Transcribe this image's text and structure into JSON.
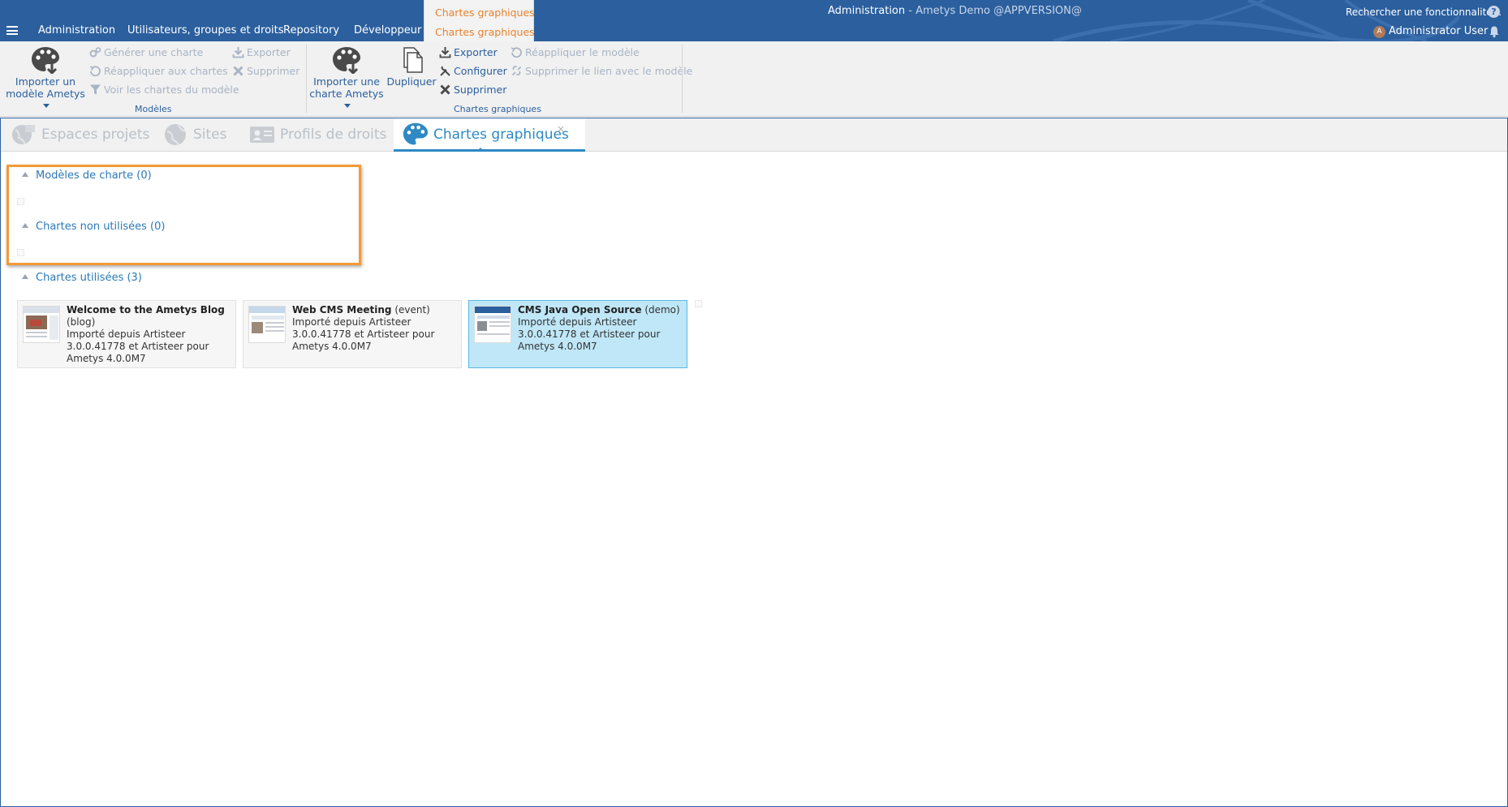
{
  "topbar": {
    "main_tabs": [
      "Administration",
      "Utilisateurs, groupes et droits",
      "Repository",
      "Développeur"
    ],
    "context_group_label": "Chartes graphiques",
    "context_tab": "Chartes graphiques",
    "title_main": "Administration",
    "title_rest": " - Ametys Demo @APPVERSION@",
    "search_feature": "Rechercher une fonctionnalité...",
    "user_initial": "A",
    "user_name": "Administrator User",
    "help_icon": "?"
  },
  "ribbon": {
    "models_group": {
      "title": "Modèles",
      "import_label_1": "Importer un",
      "import_label_2": "modèle Ametys",
      "generate": "Générer une charte",
      "reapply": "Réappliquer aux chartes",
      "view_charts": "Voir les chartes du modèle",
      "export": "Exporter",
      "delete": "Supprimer"
    },
    "charts_group": {
      "title": "Chartes graphiques",
      "import_label_1": "Importer une",
      "import_label_2": "charte Ametys",
      "duplicate": "Dupliquer",
      "export": "Exporter",
      "configure": "Configurer",
      "delete": "Supprimer",
      "reapply_model": "Réappliquer le modèle",
      "remove_link": "Supprimer le lien avec le modèle"
    }
  },
  "tool_tabs": {
    "tabs": [
      "Espaces projets",
      "Sites",
      "Profils de droits",
      "Chartes graphiques"
    ],
    "close": "×"
  },
  "sections": {
    "models": "Modèles de charte (0)",
    "unused": "Chartes non utilisées (0)",
    "used": "Chartes utilisées (3)"
  },
  "cards": [
    {
      "name": "Welcome to the Ametys Blog",
      "tag": "(blog)",
      "desc": "Importé depuis Artisteer 3.0.0.41778 et Artisteer pour Ametys 4.0.0M7"
    },
    {
      "name": "Web CMS Meeting",
      "tag": "(event)",
      "desc": "Importé depuis Artisteer 3.0.0.41778 et Artisteer pour Ametys 4.0.0M7"
    },
    {
      "name": "CMS Java Open Source",
      "tag": "(demo)",
      "desc": "Importé depuis Artisteer 3.0.0.41778 et Artisteer pour Ametys 4.0.0M7"
    }
  ],
  "colors": {
    "topbar": "#2b5f9e",
    "accent_orange": "#e8822c",
    "highlight_orange": "#f29a38",
    "active_tab_blue": "#2e89c4",
    "selected_card": "#bfe7f7"
  }
}
